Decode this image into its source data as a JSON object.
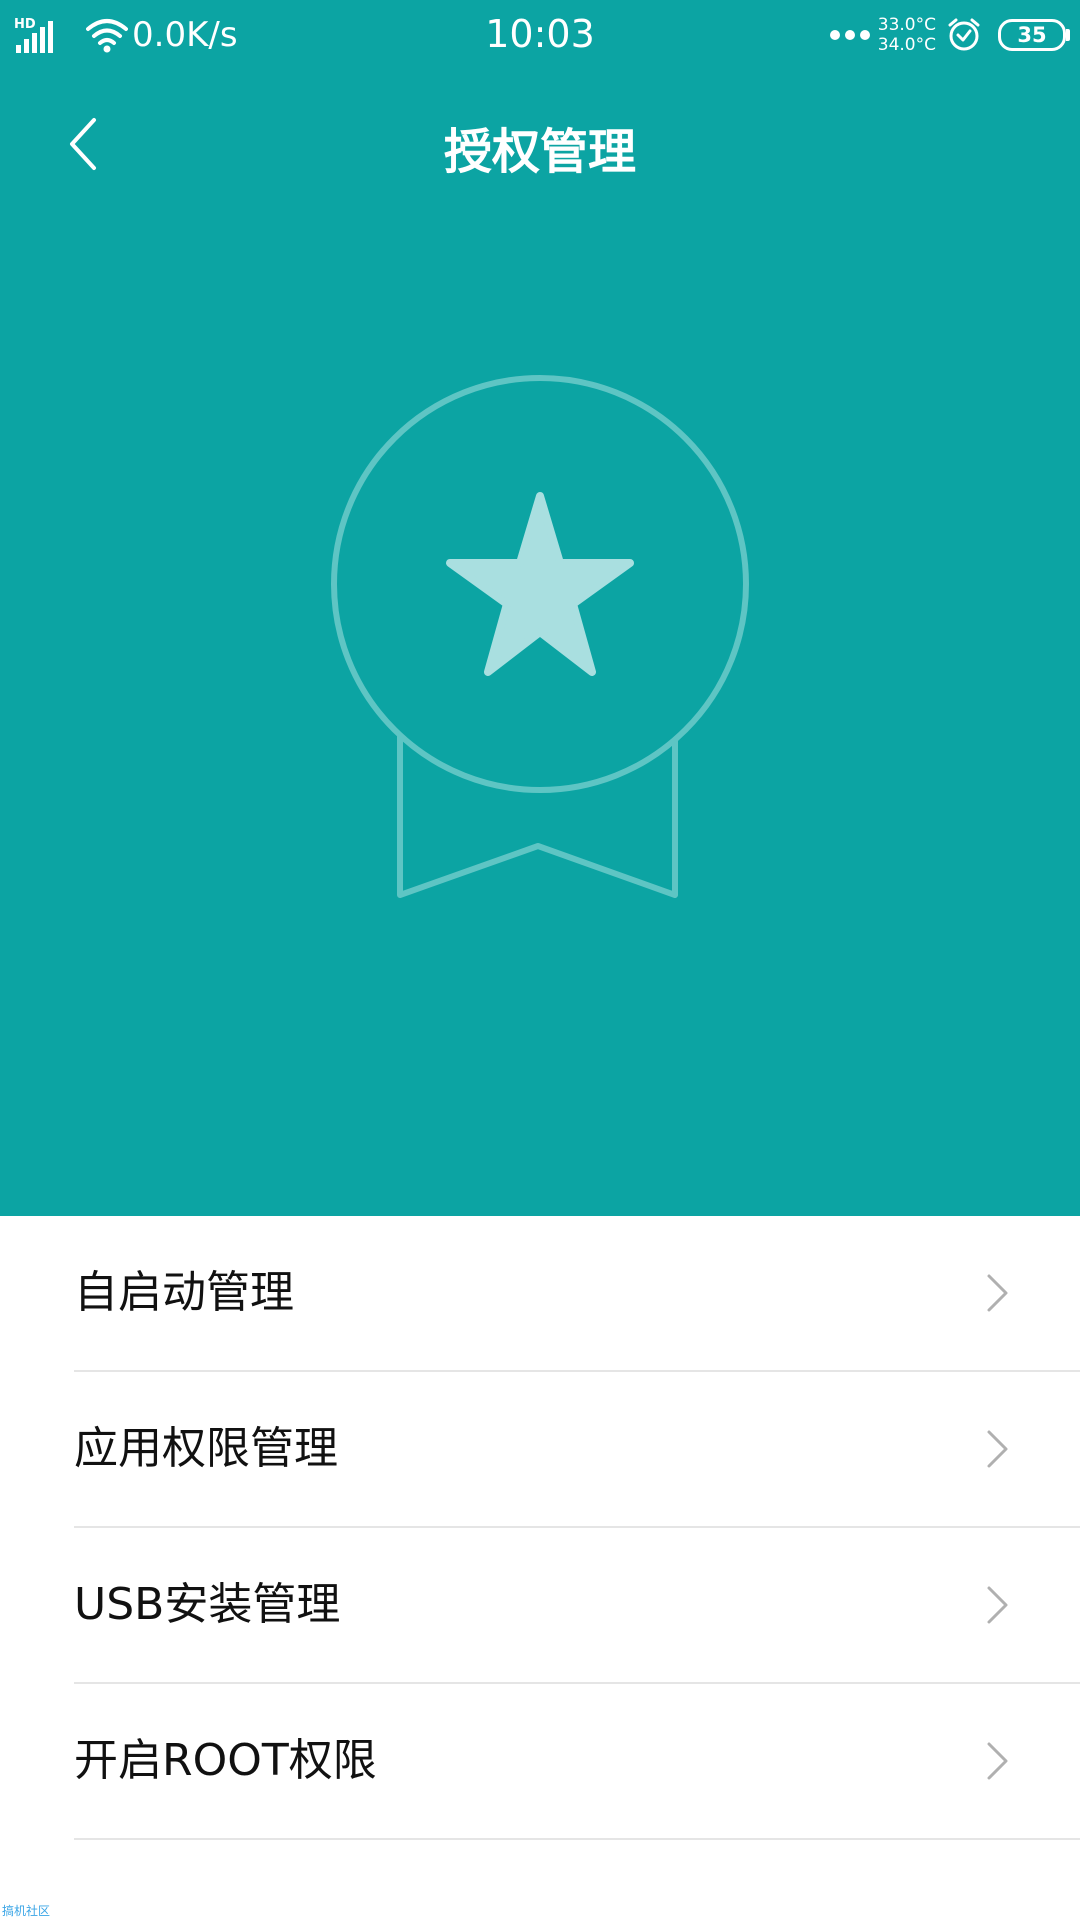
{
  "status_bar": {
    "network_badge": "HD",
    "speed": "0.0K/s",
    "time": "10:03",
    "temp_high": "33.0°C",
    "temp_low": "34.0°C",
    "battery": "35",
    "icons": [
      "signal-icon",
      "wifi-icon",
      "more-dots-icon",
      "alarm-icon",
      "battery-icon"
    ]
  },
  "title_bar": {
    "title": "授权管理",
    "back_icon": "back-arrow-icon"
  },
  "hero": {
    "icon": "medal-star-icon",
    "colors": {
      "background": "#0ca4a3",
      "outline": "#5ec5c4",
      "star": "#a9dfe0"
    }
  },
  "menu": {
    "items": [
      {
        "label": "自启动管理"
      },
      {
        "label": "应用权限管理"
      },
      {
        "label": "USB安装管理"
      },
      {
        "label": "开启ROOT权限"
      }
    ],
    "chevron_icon": "chevron-right-icon"
  },
  "watermark": "搞机社区"
}
